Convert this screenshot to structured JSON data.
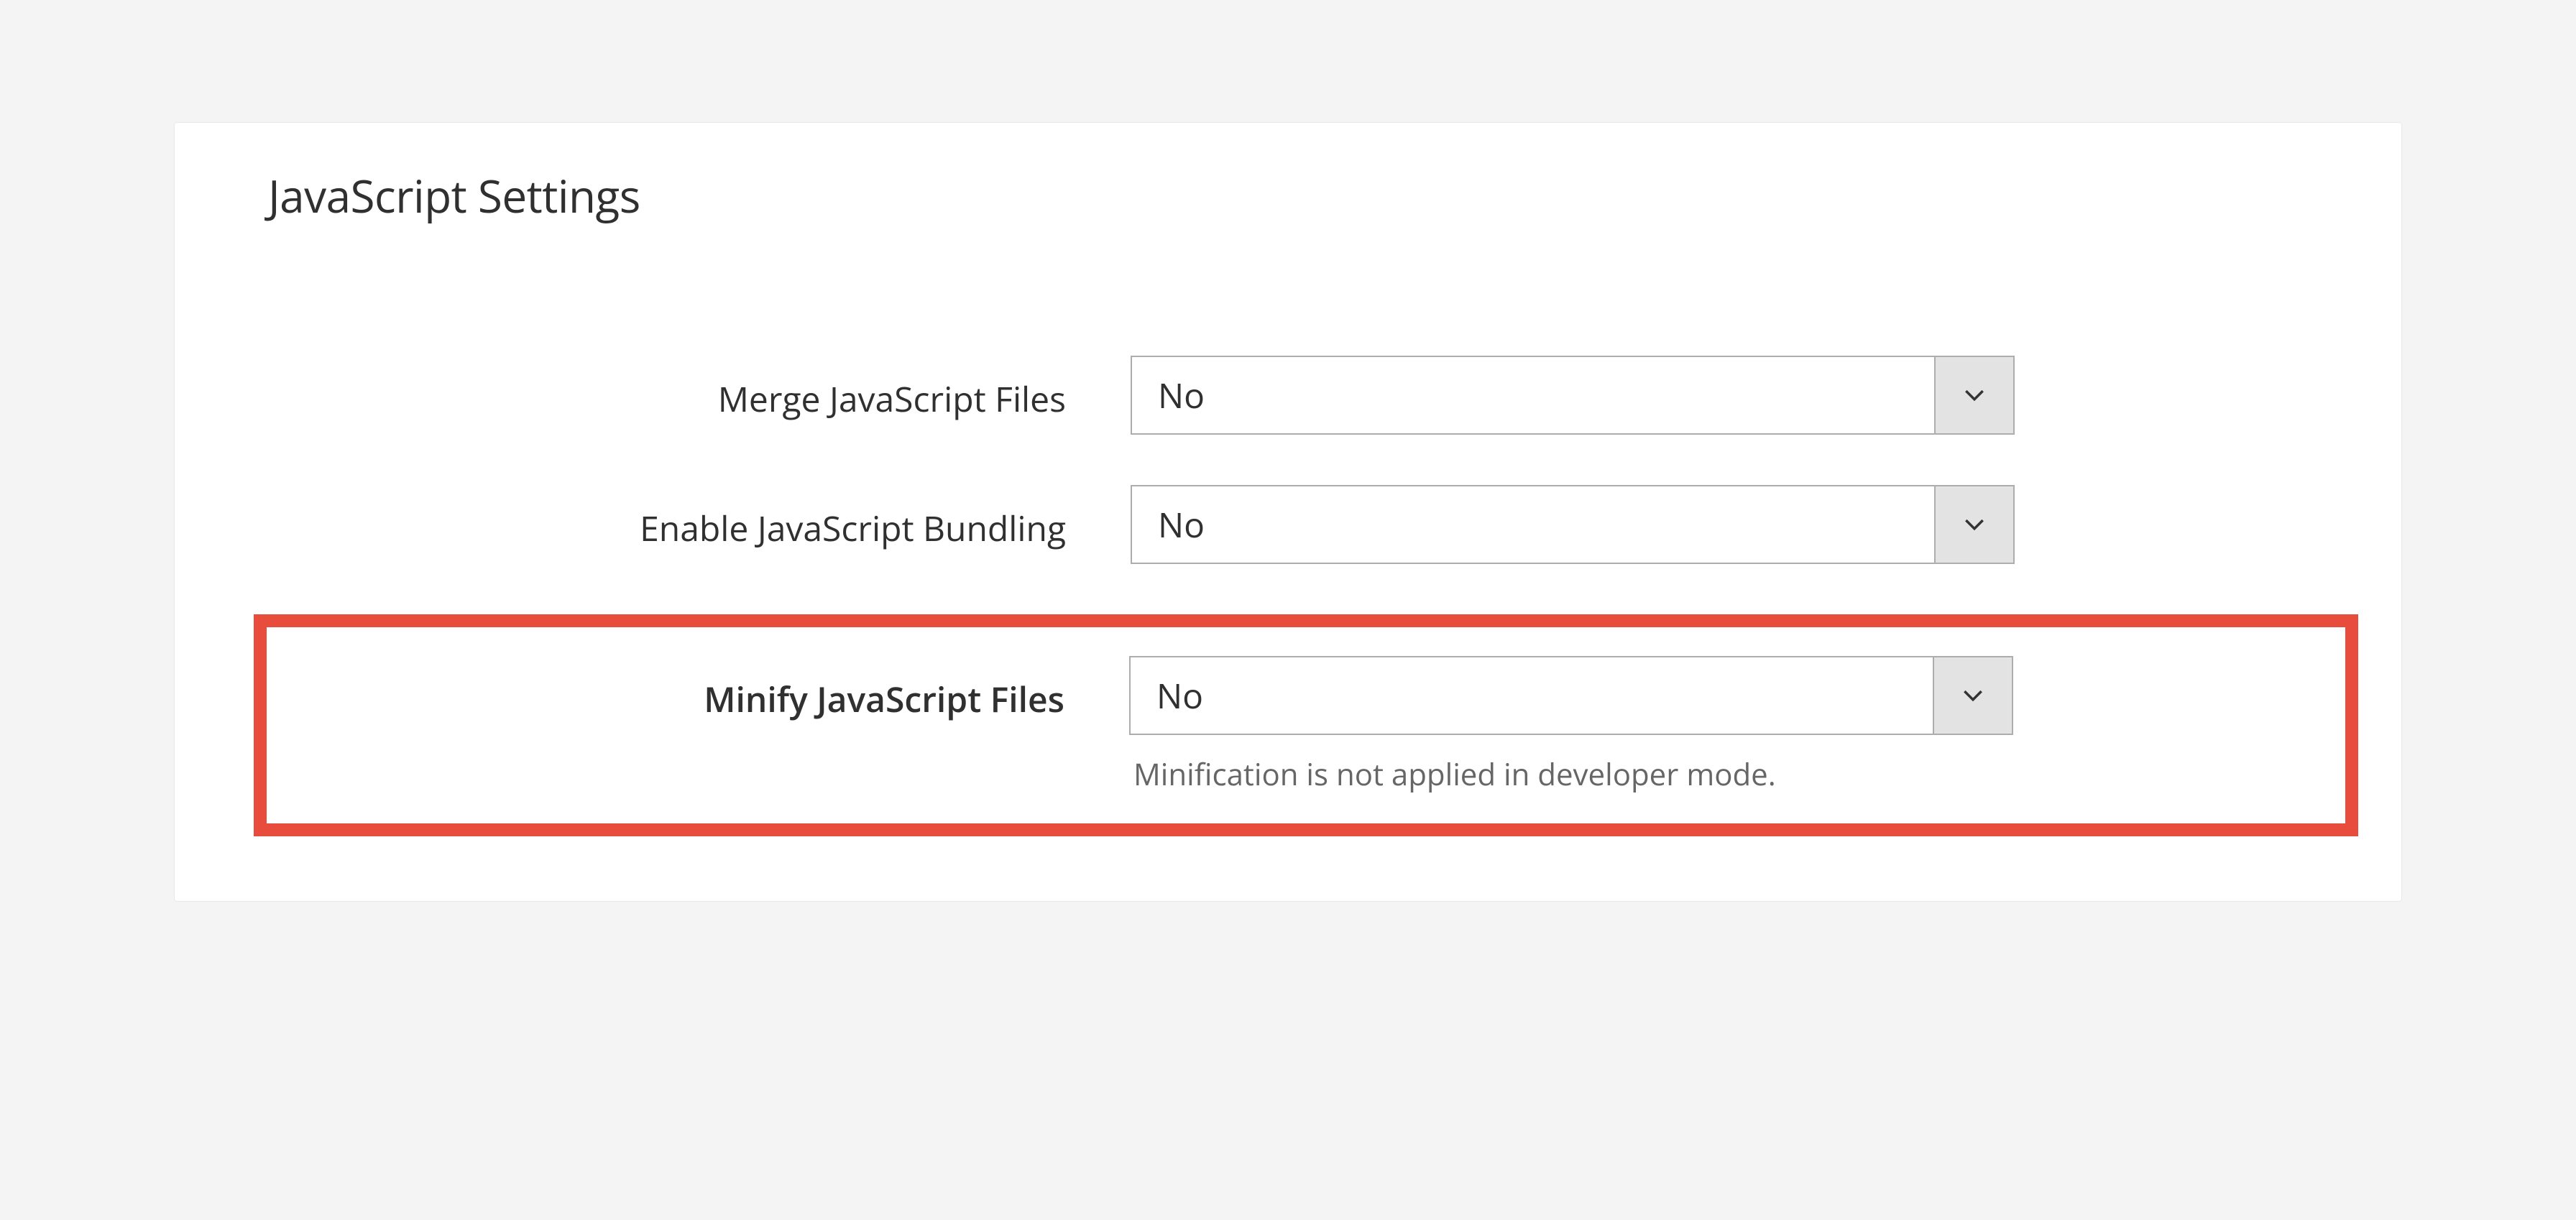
{
  "section": {
    "title": "JavaScript Settings"
  },
  "fields": {
    "merge": {
      "label": "Merge JavaScript Files",
      "value": "No"
    },
    "bundling": {
      "label": "Enable JavaScript Bundling",
      "value": "No"
    },
    "minify": {
      "label": "Minify JavaScript Files",
      "value": "No",
      "helper": "Minification is not applied in developer mode."
    }
  }
}
